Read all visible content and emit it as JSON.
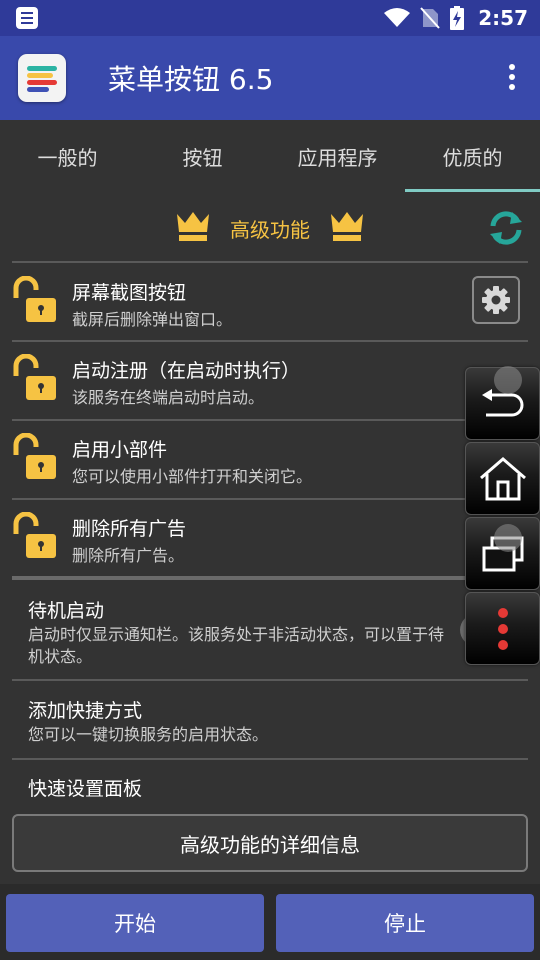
{
  "status_bar": {
    "time": "2:57",
    "icons": [
      "notification-icon",
      "wifi-icon",
      "no-sim-icon",
      "battery-charging-icon"
    ]
  },
  "app_bar": {
    "title": "菜单按钮 6.5",
    "overflow_icon": "more-vert-icon"
  },
  "tabs": [
    {
      "label": "一般的",
      "active": false
    },
    {
      "label": "按钮",
      "active": false
    },
    {
      "label": "应用程序",
      "active": false
    },
    {
      "label": "优质的",
      "active": true
    }
  ],
  "premium": {
    "title": "高级功能",
    "crown_color": "#f6c343",
    "refresh_color": "#26a69a"
  },
  "premium_items": [
    {
      "title": "屏幕截图按钮",
      "subtitle": "截屏后删除弹出窗口。",
      "icon": "unlock-icon",
      "has_settings": true
    },
    {
      "title": "启动注册（在启动时执行）",
      "subtitle": "该服务在终端启动时启动。",
      "icon": "unlock-icon"
    },
    {
      "title": "启用小部件",
      "subtitle": "您可以使用小部件打开和关闭它。",
      "icon": "unlock-icon"
    },
    {
      "title": "删除所有广告",
      "subtitle": "删除所有广告。",
      "icon": "unlock-icon"
    }
  ],
  "items": [
    {
      "title": "待机启动",
      "subtitle": "启动时仅显示通知栏。该服务处于非活动状态，可以置于待机状态。"
    },
    {
      "title": "添加快捷方式",
      "subtitle": "您可以一键切换服务的启用状态。"
    },
    {
      "title": "快速设置面板",
      "subtitle": ""
    }
  ],
  "details_button": "高级功能的详细信息",
  "bottom_buttons": {
    "start": "开始",
    "stop": "停止"
  },
  "floating_nav": [
    "back-icon",
    "home-icon",
    "recents-icon",
    "menu-dots-icon"
  ],
  "colors": {
    "status_bar": "#2f3a99",
    "app_bar": "#3949ab",
    "background": "#333333",
    "tab_indicator": "#80cbc4",
    "accent_gold": "#f6c343",
    "button": "#5361b8"
  }
}
